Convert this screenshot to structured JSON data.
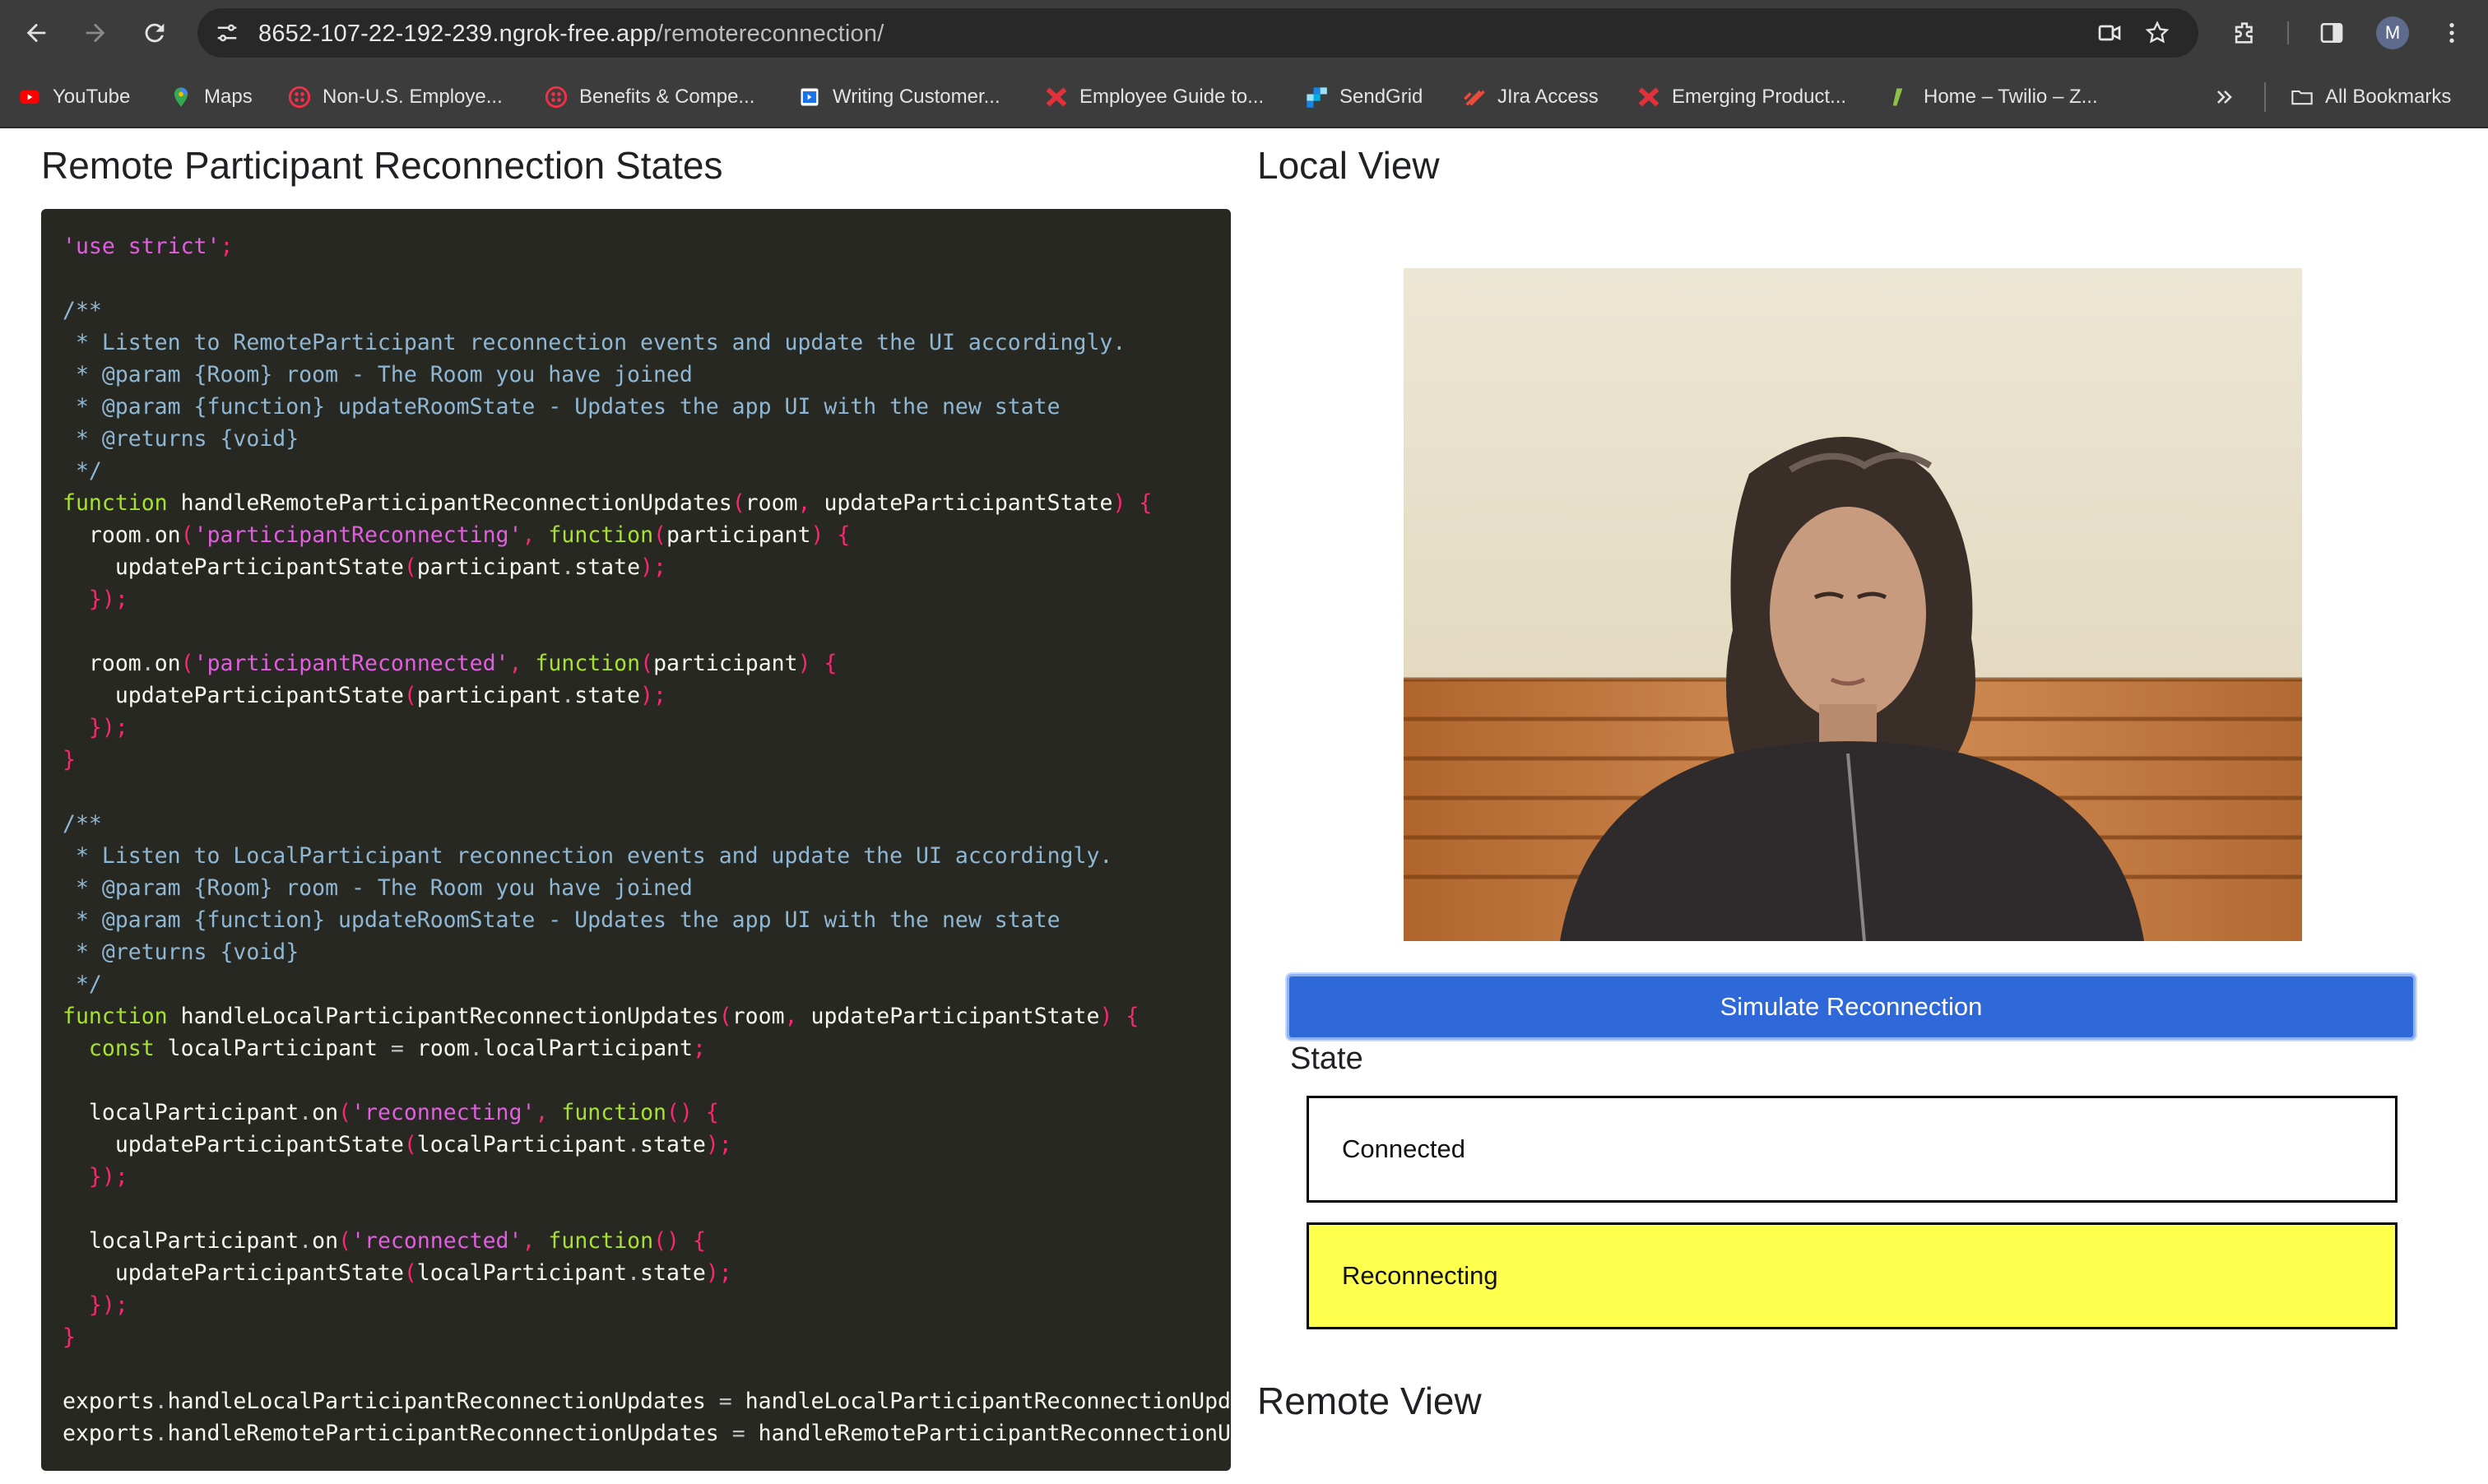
{
  "browser": {
    "url_host": "8652-107-22-192-239.ngrok-free.app",
    "url_path": "/remotereconnection/",
    "profile_initial": "M",
    "bookmarks": [
      {
        "label": "YouTube",
        "icon": "youtube-icon",
        "color": "#ff0000"
      },
      {
        "label": "Maps",
        "icon": "maps-icon",
        "color": "#34a853"
      },
      {
        "label": "Non-U.S. Employe...",
        "icon": "twilio-icon",
        "color": "#f22f46"
      },
      {
        "label": "Benefits & Compe...",
        "icon": "twilio-icon",
        "color": "#f22f46"
      },
      {
        "label": "Writing Customer...",
        "icon": "document-icon",
        "color": "#1a73e8"
      },
      {
        "label": "Employee Guide to...",
        "icon": "sendgrid-x-icon",
        "color": "#e3313a"
      },
      {
        "label": "SendGrid",
        "icon": "sendgrid-icon",
        "color": "#1a82e2"
      },
      {
        "label": "JIra Access",
        "icon": "jira-icon",
        "color": "#e94b3c"
      },
      {
        "label": "Emerging Product...",
        "icon": "sendgrid-x-icon",
        "color": "#e3313a"
      },
      {
        "label": "Home – Twilio – Z...",
        "icon": "zendesk-icon",
        "color": "#8bc34a"
      }
    ],
    "all_bookmarks_label": "All Bookmarks"
  },
  "page": {
    "title": "Remote Participant Reconnection States",
    "local_view_heading": "Local View",
    "simulate_button_label": "Simulate Reconnection",
    "state_heading": "State",
    "states": [
      {
        "label": "Connected",
        "color": "#ffffff"
      },
      {
        "label": "Reconnecting",
        "color": "#ffff4d"
      }
    ],
    "remote_view_heading": "Remote View"
  },
  "code": {
    "lines": [
      "'use strict';",
      "",
      "/**",
      " * Listen to RemoteParticipant reconnection events and update the UI accordingly.",
      " * @param {Room} room - The Room you have joined",
      " * @param {function} updateRoomState - Updates the app UI with the new state",
      " * @returns {void}",
      " */",
      "function handleRemoteParticipantReconnectionUpdates(room, updateParticipantState) {",
      "  room.on('participantReconnecting', function(participant) {",
      "    updateParticipantState(participant.state);",
      "  });",
      "",
      "  room.on('participantReconnected', function(participant) {",
      "    updateParticipantState(participant.state);",
      "  });",
      "}",
      "",
      "/**",
      " * Listen to LocalParticipant reconnection events and update the UI accordingly.",
      " * @param {Room} room - The Room you have joined",
      " * @param {function} updateRoomState - Updates the app UI with the new state",
      " * @returns {void}",
      " */",
      "function handleLocalParticipantReconnectionUpdates(room, updateParticipantState) {",
      "  const localParticipant = room.localParticipant;",
      "",
      "  localParticipant.on('reconnecting', function() {",
      "    updateParticipantState(localParticipant.state);",
      "  });",
      "",
      "  localParticipant.on('reconnected', function() {",
      "    updateParticipantState(localParticipant.state);",
      "  });",
      "}",
      "",
      "exports.handleLocalParticipantReconnectionUpdates = handleLocalParticipantReconnectionUpdat",
      "exports.handleRemoteParticipantReconnectionUpdates = handleRemoteParticipantReconnectionUpd"
    ]
  },
  "colors": {
    "code_bg": "#272822",
    "button_bg": "#2f68d8",
    "reconnecting_bg": "#ffff4d",
    "chrome_bg": "#3c3c3c"
  }
}
